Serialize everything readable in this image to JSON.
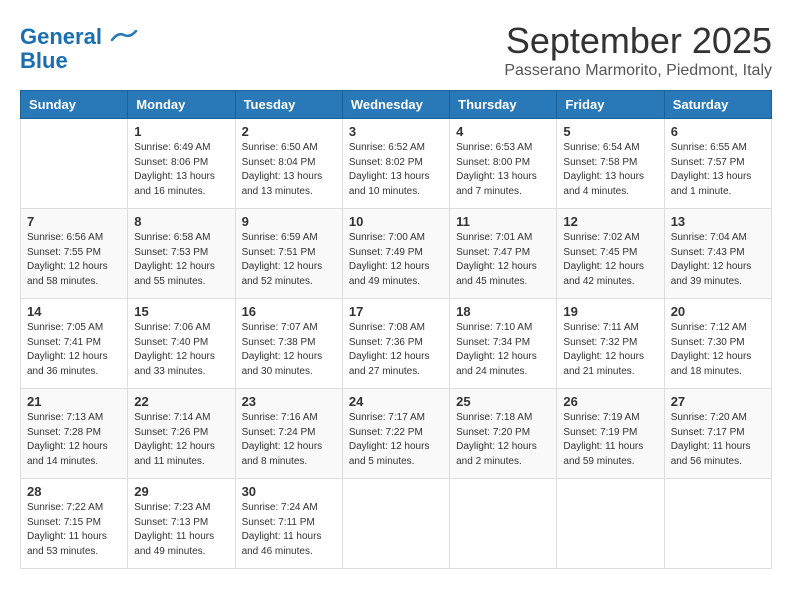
{
  "header": {
    "logo_line1": "General",
    "logo_line2": "Blue",
    "month_title": "September 2025",
    "location": "Passerano Marmorito, Piedmont, Italy"
  },
  "weekdays": [
    "Sunday",
    "Monday",
    "Tuesday",
    "Wednesday",
    "Thursday",
    "Friday",
    "Saturday"
  ],
  "weeks": [
    [
      {
        "day": "",
        "info": ""
      },
      {
        "day": "1",
        "info": "Sunrise: 6:49 AM\nSunset: 8:06 PM\nDaylight: 13 hours\nand 16 minutes."
      },
      {
        "day": "2",
        "info": "Sunrise: 6:50 AM\nSunset: 8:04 PM\nDaylight: 13 hours\nand 13 minutes."
      },
      {
        "day": "3",
        "info": "Sunrise: 6:52 AM\nSunset: 8:02 PM\nDaylight: 13 hours\nand 10 minutes."
      },
      {
        "day": "4",
        "info": "Sunrise: 6:53 AM\nSunset: 8:00 PM\nDaylight: 13 hours\nand 7 minutes."
      },
      {
        "day": "5",
        "info": "Sunrise: 6:54 AM\nSunset: 7:58 PM\nDaylight: 13 hours\nand 4 minutes."
      },
      {
        "day": "6",
        "info": "Sunrise: 6:55 AM\nSunset: 7:57 PM\nDaylight: 13 hours\nand 1 minute."
      }
    ],
    [
      {
        "day": "7",
        "info": "Sunrise: 6:56 AM\nSunset: 7:55 PM\nDaylight: 12 hours\nand 58 minutes."
      },
      {
        "day": "8",
        "info": "Sunrise: 6:58 AM\nSunset: 7:53 PM\nDaylight: 12 hours\nand 55 minutes."
      },
      {
        "day": "9",
        "info": "Sunrise: 6:59 AM\nSunset: 7:51 PM\nDaylight: 12 hours\nand 52 minutes."
      },
      {
        "day": "10",
        "info": "Sunrise: 7:00 AM\nSunset: 7:49 PM\nDaylight: 12 hours\nand 49 minutes."
      },
      {
        "day": "11",
        "info": "Sunrise: 7:01 AM\nSunset: 7:47 PM\nDaylight: 12 hours\nand 45 minutes."
      },
      {
        "day": "12",
        "info": "Sunrise: 7:02 AM\nSunset: 7:45 PM\nDaylight: 12 hours\nand 42 minutes."
      },
      {
        "day": "13",
        "info": "Sunrise: 7:04 AM\nSunset: 7:43 PM\nDaylight: 12 hours\nand 39 minutes."
      }
    ],
    [
      {
        "day": "14",
        "info": "Sunrise: 7:05 AM\nSunset: 7:41 PM\nDaylight: 12 hours\nand 36 minutes."
      },
      {
        "day": "15",
        "info": "Sunrise: 7:06 AM\nSunset: 7:40 PM\nDaylight: 12 hours\nand 33 minutes."
      },
      {
        "day": "16",
        "info": "Sunrise: 7:07 AM\nSunset: 7:38 PM\nDaylight: 12 hours\nand 30 minutes."
      },
      {
        "day": "17",
        "info": "Sunrise: 7:08 AM\nSunset: 7:36 PM\nDaylight: 12 hours\nand 27 minutes."
      },
      {
        "day": "18",
        "info": "Sunrise: 7:10 AM\nSunset: 7:34 PM\nDaylight: 12 hours\nand 24 minutes."
      },
      {
        "day": "19",
        "info": "Sunrise: 7:11 AM\nSunset: 7:32 PM\nDaylight: 12 hours\nand 21 minutes."
      },
      {
        "day": "20",
        "info": "Sunrise: 7:12 AM\nSunset: 7:30 PM\nDaylight: 12 hours\nand 18 minutes."
      }
    ],
    [
      {
        "day": "21",
        "info": "Sunrise: 7:13 AM\nSunset: 7:28 PM\nDaylight: 12 hours\nand 14 minutes."
      },
      {
        "day": "22",
        "info": "Sunrise: 7:14 AM\nSunset: 7:26 PM\nDaylight: 12 hours\nand 11 minutes."
      },
      {
        "day": "23",
        "info": "Sunrise: 7:16 AM\nSunset: 7:24 PM\nDaylight: 12 hours\nand 8 minutes."
      },
      {
        "day": "24",
        "info": "Sunrise: 7:17 AM\nSunset: 7:22 PM\nDaylight: 12 hours\nand 5 minutes."
      },
      {
        "day": "25",
        "info": "Sunrise: 7:18 AM\nSunset: 7:20 PM\nDaylight: 12 hours\nand 2 minutes."
      },
      {
        "day": "26",
        "info": "Sunrise: 7:19 AM\nSunset: 7:19 PM\nDaylight: 11 hours\nand 59 minutes."
      },
      {
        "day": "27",
        "info": "Sunrise: 7:20 AM\nSunset: 7:17 PM\nDaylight: 11 hours\nand 56 minutes."
      }
    ],
    [
      {
        "day": "28",
        "info": "Sunrise: 7:22 AM\nSunset: 7:15 PM\nDaylight: 11 hours\nand 53 minutes."
      },
      {
        "day": "29",
        "info": "Sunrise: 7:23 AM\nSunset: 7:13 PM\nDaylight: 11 hours\nand 49 minutes."
      },
      {
        "day": "30",
        "info": "Sunrise: 7:24 AM\nSunset: 7:11 PM\nDaylight: 11 hours\nand 46 minutes."
      },
      {
        "day": "",
        "info": ""
      },
      {
        "day": "",
        "info": ""
      },
      {
        "day": "",
        "info": ""
      },
      {
        "day": "",
        "info": ""
      }
    ]
  ]
}
